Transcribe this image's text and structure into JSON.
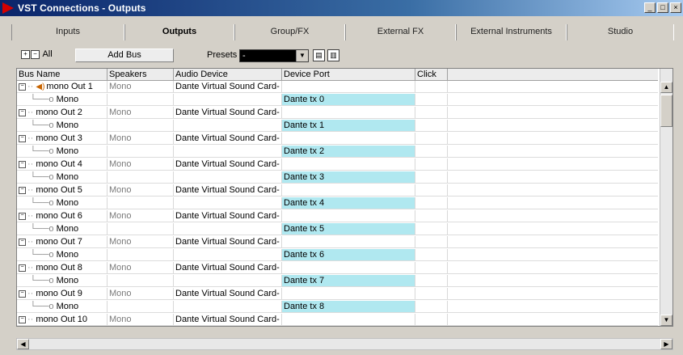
{
  "window": {
    "title": "VST Connections - Outputs",
    "minimize": "_",
    "maximize": "□",
    "close": "×"
  },
  "tabs": [
    {
      "label": "Inputs"
    },
    {
      "label": "Outputs"
    },
    {
      "label": "Group/FX"
    },
    {
      "label": "External FX"
    },
    {
      "label": "External Instruments"
    },
    {
      "label": "Studio"
    }
  ],
  "toolbar": {
    "expand_all": "All",
    "add_bus": "Add Bus",
    "presets_label": "Presets",
    "presets_value": "-"
  },
  "columns": [
    "Bus Name",
    "Speakers",
    "Audio Device",
    "Device Port",
    "Click"
  ],
  "rows": [
    {
      "kind": "bus",
      "name": "mono Out 1",
      "speakers": "Mono",
      "device": "Dante Virtual Sound Card-",
      "port": "",
      "speaker_icon": true
    },
    {
      "kind": "child",
      "name": "Mono",
      "speakers": "",
      "device": "",
      "port": "Dante tx 0"
    },
    {
      "kind": "bus",
      "name": "mono Out 2",
      "speakers": "Mono",
      "device": "Dante Virtual Sound Card-",
      "port": ""
    },
    {
      "kind": "child",
      "name": "Mono",
      "speakers": "",
      "device": "",
      "port": "Dante tx 1"
    },
    {
      "kind": "bus",
      "name": "mono Out 3",
      "speakers": "Mono",
      "device": "Dante Virtual Sound Card-",
      "port": ""
    },
    {
      "kind": "child",
      "name": "Mono",
      "speakers": "",
      "device": "",
      "port": "Dante tx 2"
    },
    {
      "kind": "bus",
      "name": "mono Out 4",
      "speakers": "Mono",
      "device": "Dante Virtual Sound Card-",
      "port": ""
    },
    {
      "kind": "child",
      "name": "Mono",
      "speakers": "",
      "device": "",
      "port": "Dante tx 3"
    },
    {
      "kind": "bus",
      "name": "mono Out 5",
      "speakers": "Mono",
      "device": "Dante Virtual Sound Card-",
      "port": ""
    },
    {
      "kind": "child",
      "name": "Mono",
      "speakers": "",
      "device": "",
      "port": "Dante tx 4"
    },
    {
      "kind": "bus",
      "name": "mono Out 6",
      "speakers": "Mono",
      "device": "Dante Virtual Sound Card-",
      "port": ""
    },
    {
      "kind": "child",
      "name": "Mono",
      "speakers": "",
      "device": "",
      "port": "Dante tx 5"
    },
    {
      "kind": "bus",
      "name": "mono Out 7",
      "speakers": "Mono",
      "device": "Dante Virtual Sound Card-",
      "port": ""
    },
    {
      "kind": "child",
      "name": "Mono",
      "speakers": "",
      "device": "",
      "port": "Dante tx 6"
    },
    {
      "kind": "bus",
      "name": "mono Out 8",
      "speakers": "Mono",
      "device": "Dante Virtual Sound Card-",
      "port": ""
    },
    {
      "kind": "child",
      "name": "Mono",
      "speakers": "",
      "device": "",
      "port": "Dante tx 7"
    },
    {
      "kind": "bus",
      "name": "mono Out 9",
      "speakers": "Mono",
      "device": "Dante Virtual Sound Card-",
      "port": ""
    },
    {
      "kind": "child",
      "name": "Mono",
      "speakers": "",
      "device": "",
      "port": "Dante tx 8"
    },
    {
      "kind": "bus",
      "name": "mono Out 10",
      "speakers": "Mono",
      "device": "Dante Virtual Sound Card-",
      "port": ""
    }
  ],
  "colors": {
    "port_highlight": "#b0e8f0",
    "title_bar": "#0a246a",
    "speaker_icon": "#c86400"
  },
  "icons": {
    "app": "vst-logo-icon",
    "speaker": "speaker-icon",
    "tree_toggle": "minus-box-icon"
  }
}
